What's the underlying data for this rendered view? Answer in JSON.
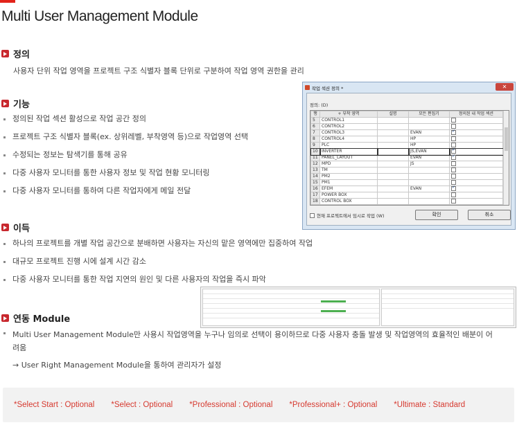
{
  "page": {
    "title": "Multi User Management Module",
    "accent": "#c8282e"
  },
  "sections": {
    "definition": {
      "heading": "정의",
      "text": "사용자 단위 작업 영역을 프로젝트 구조 식별자 블록 단위로 구분하여 작업 영역 권한을 관리"
    },
    "features": {
      "heading": "기능",
      "items": [
        "정의된 작업 섹션 활성으로 작업 공간 정의",
        "프로젝트 구조 식별자 블록(ex. 상위레벨, 부착영역 등)으로 작업영역 선택",
        "수정되는 정보는 탐색기를 통해 공유",
        "다중 사용자 모니터를 통한 사용자 정보 및 작업 현황 모니터링",
        "다중 사용자 모니터를 통하여 다른 작업자에게 메일 전달"
      ]
    },
    "benefits": {
      "heading": "이득",
      "items": [
        "하나의 프로젝트를 개별 작업 공간으로 분배하면 사용자는 자신의 맡은 영역에만 집중하여 작업",
        "대규모 프로젝트 진행 시에 설계 시간 감소",
        "다중 사용자 모니터를 통한 작업 지연의 원인 및 다른 사용자의 작업을 즉시 파악"
      ]
    },
    "integration": {
      "heading": "연동 Module",
      "items": [
        "Multi User Management Module만 사용시 작업영역을 누구나 임의로 선택이 용이하므로 다중 사용자 충돌 발생 및 작업영역의 효율적인 배분이 어려움"
      ],
      "note": "→ User Right Management Module을 통하여 관리자가 설정"
    }
  },
  "footer": {
    "options": [
      "*Select Start : Optional",
      "*Select : Optional",
      "*Professional : Optional",
      "*Professional+ : Optional",
      "*Ultimate : Standard"
    ]
  },
  "dialog": {
    "title": "작업 섹션 정의 *",
    "label": "정의: (D)",
    "columns": [
      "행",
      "+ 부착 영역",
      "설명",
      "모든 편집기",
      "정의된 내 작업 섹션"
    ],
    "rows": [
      {
        "num": "5",
        "area": "CONTROL1",
        "desc": "",
        "editor": "",
        "checked": false
      },
      {
        "num": "6",
        "area": "CONTROL2",
        "desc": "",
        "editor": "",
        "checked": false
      },
      {
        "num": "7",
        "area": "CONTROL3",
        "desc": "",
        "editor": "EVAN",
        "checked": true
      },
      {
        "num": "8",
        "area": "CONTROL4",
        "desc": "",
        "editor": "HP",
        "checked": false
      },
      {
        "num": "9",
        "area": "PLC",
        "desc": "",
        "editor": "HP",
        "checked": false
      },
      {
        "num": "10",
        "area": "INVERTER",
        "desc": "",
        "editor": "JS,EVAN",
        "checked": true
      },
      {
        "num": "11",
        "area": "PANEL_LAYOUT",
        "desc": "",
        "editor": "EVAN",
        "checked": true
      },
      {
        "num": "12",
        "area": "MPD",
        "desc": "",
        "editor": "JS",
        "checked": false
      },
      {
        "num": "13",
        "area": "TM",
        "desc": "",
        "editor": "",
        "checked": false
      },
      {
        "num": "14",
        "area": "PM2",
        "desc": "",
        "editor": "",
        "checked": false
      },
      {
        "num": "15",
        "area": "PM1",
        "desc": "",
        "editor": "",
        "checked": false
      },
      {
        "num": "16",
        "area": "EFEM",
        "desc": "",
        "editor": "EVAN",
        "checked": true
      },
      {
        "num": "17",
        "area": "POWER BOX",
        "desc": "",
        "editor": "",
        "checked": false
      },
      {
        "num": "18",
        "area": "CONTROL BOX",
        "desc": "",
        "editor": "",
        "checked": false
      }
    ],
    "footer_check": "현재 프로젝트에서 임시로 작업 (W)",
    "ok_label": "확인",
    "cancel_label": "취소"
  }
}
